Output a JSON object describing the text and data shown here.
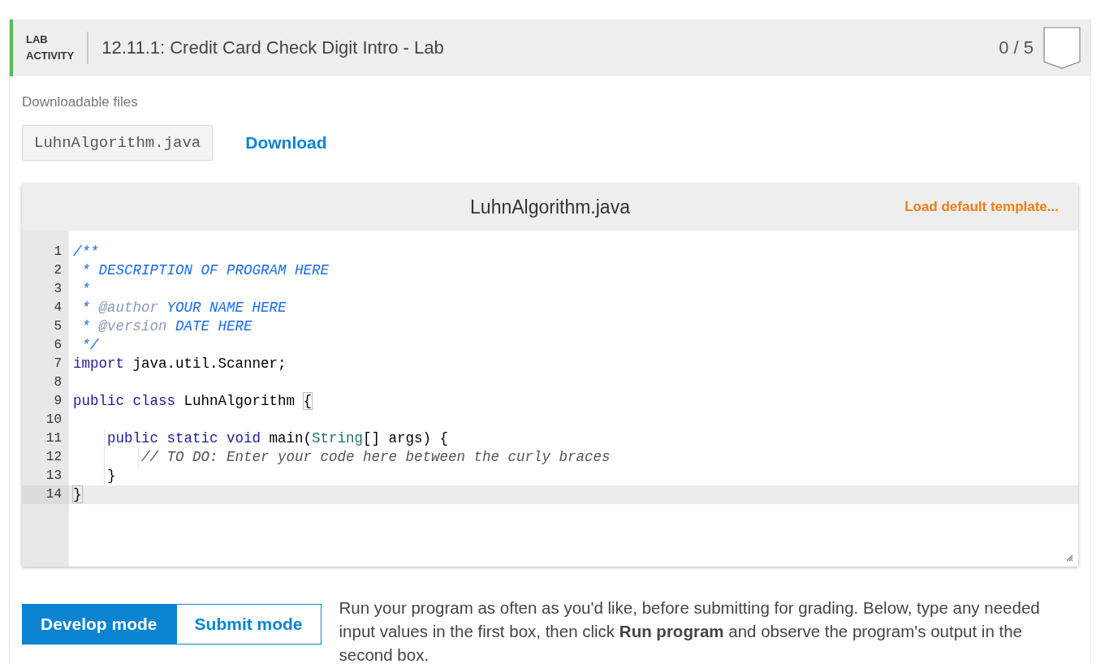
{
  "header": {
    "badge_lines": [
      "LAB",
      "ACTIVITY"
    ],
    "title": "12.11.1: Credit Card Check Digit Intro - Lab",
    "score": "0 / 5"
  },
  "downloads": {
    "label": "Downloadable files",
    "file": "LuhnAlgorithm.java",
    "link": "Download"
  },
  "editor": {
    "filename": "LuhnAlgorithm.java",
    "template_link": "Load default template...",
    "lines": [
      {
        "number": "1",
        "active": false,
        "tokens": [
          {
            "kind": "comment",
            "text": "/**"
          }
        ]
      },
      {
        "number": "2",
        "active": false,
        "tokens": [
          {
            "kind": "comment",
            "text": " * DESCRIPTION OF PROGRAM HERE"
          }
        ]
      },
      {
        "number": "3",
        "active": false,
        "tokens": [
          {
            "kind": "comment",
            "text": " *"
          }
        ]
      },
      {
        "number": "4",
        "active": false,
        "tokens": [
          {
            "kind": "comment",
            "text": " * "
          },
          {
            "kind": "doctag",
            "text": "@author"
          },
          {
            "kind": "comment",
            "text": " YOUR NAME HERE"
          }
        ]
      },
      {
        "number": "5",
        "active": false,
        "tokens": [
          {
            "kind": "comment",
            "text": " * "
          },
          {
            "kind": "doctag",
            "text": "@version"
          },
          {
            "kind": "comment",
            "text": " DATE HERE"
          }
        ]
      },
      {
        "number": "6",
        "active": false,
        "tokens": [
          {
            "kind": "comment",
            "text": " */"
          }
        ]
      },
      {
        "number": "7",
        "active": false,
        "tokens": [
          {
            "kind": "keyword",
            "text": "import"
          },
          {
            "kind": "plain",
            "text": " java.util.Scanner;"
          }
        ]
      },
      {
        "number": "8",
        "active": false
      },
      {
        "number": "9",
        "active": false,
        "tokens": [
          {
            "kind": "keyword",
            "text": "public class"
          },
          {
            "kind": "plain",
            "text": " LuhnAlgorithm "
          },
          {
            "kind": "bracket",
            "text": "{"
          }
        ]
      },
      {
        "number": "10",
        "active": false
      },
      {
        "number": "11",
        "active": false,
        "tokens": [
          {
            "kind": "keyword",
            "text": "    public static void"
          },
          {
            "kind": "plain",
            "text": " main("
          },
          {
            "kind": "type",
            "text": "String"
          },
          {
            "kind": "plain",
            "text": "[] args) {"
          }
        ]
      },
      {
        "number": "12",
        "active": false,
        "tokens": [
          {
            "kind": "linecomment",
            "text": "        // TO DO: Enter your code here between the curly braces"
          }
        ]
      },
      {
        "number": "13",
        "active": false,
        "tokens": [
          {
            "kind": "plain",
            "text": "    }"
          }
        ]
      },
      {
        "number": "14",
        "active": true,
        "tokens": [
          {
            "kind": "bracket",
            "text": "}"
          }
        ]
      }
    ]
  },
  "modes": [
    {
      "label": "Develop mode",
      "selected": true
    },
    {
      "label": "Submit mode",
      "selected": false
    }
  ],
  "instructions": "Run your program as often as you'd like, before submitting for grading. Below, type any needed input values in the first box, then click **Run program** and observe the program's output in the second box."
}
